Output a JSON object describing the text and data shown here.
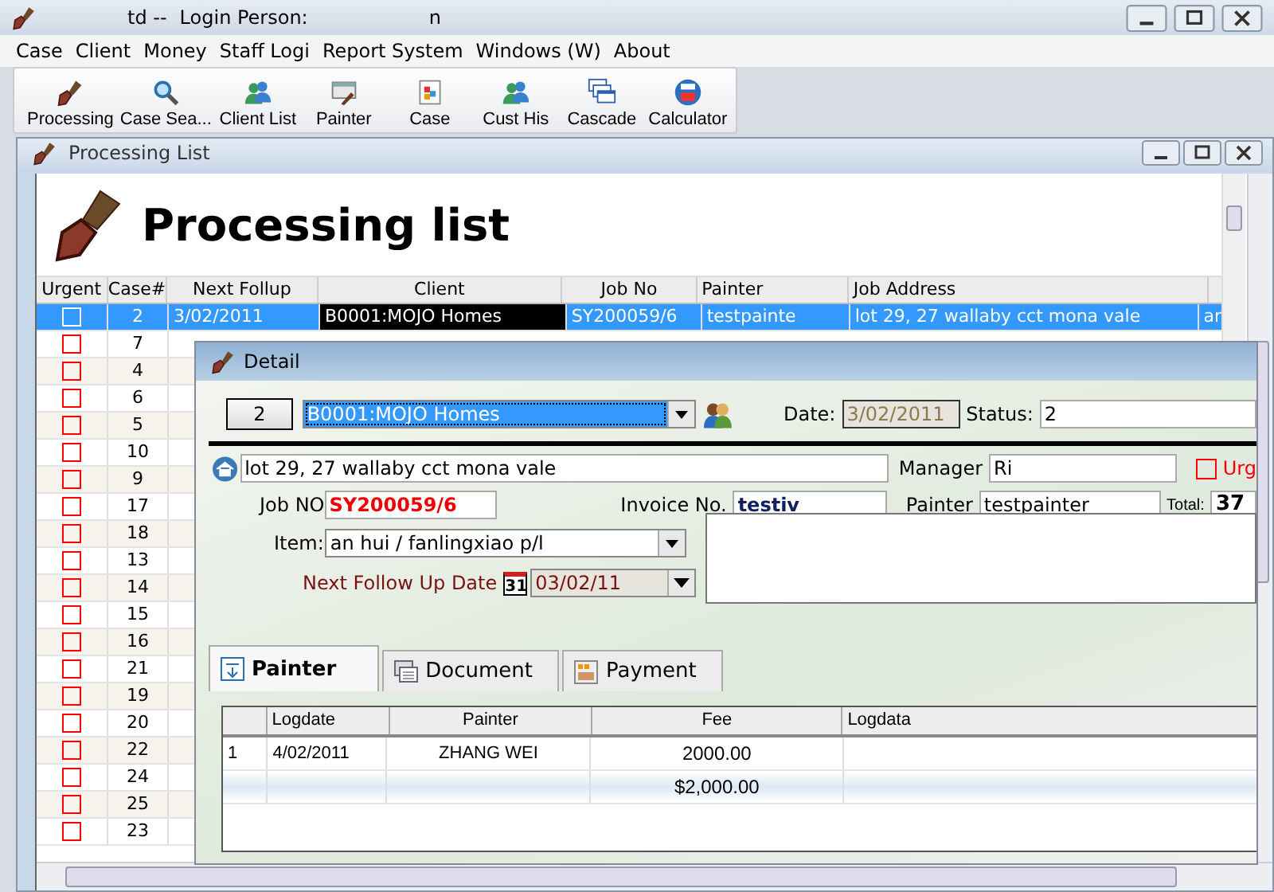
{
  "title_bar": {
    "texts": [
      "td --",
      "Login Person:",
      "n"
    ]
  },
  "menu": [
    "Case",
    "Client",
    "Money",
    "Staff Logi",
    "Report System",
    "Windows (W)",
    "About"
  ],
  "toolbar": [
    {
      "label": "Processing",
      "kind": "brush"
    },
    {
      "label": "Case Sea...",
      "kind": "search"
    },
    {
      "label": "Client List",
      "kind": "people"
    },
    {
      "label": "Painter",
      "kind": "painting"
    },
    {
      "label": "Case",
      "kind": "doc"
    },
    {
      "label": "Cust His",
      "kind": "people"
    },
    {
      "label": "Cascade",
      "kind": "cascade"
    },
    {
      "label": "Calculator",
      "kind": "calc"
    }
  ],
  "list_window": {
    "title": "Processing List",
    "heading": "Processing list",
    "columns": [
      "Urgent",
      "Case#",
      "Next Follup",
      "Client",
      "Job No",
      "Painter",
      "Job Address"
    ],
    "rows": [
      {
        "urgent": false,
        "case": "2",
        "selected": true,
        "cells": [
          "3/02/2011",
          "B0001:MOJO Homes",
          "SY200059/6",
          "testpainte",
          "lot 29, 27 wallaby cct mona vale",
          "ar"
        ]
      },
      {
        "urgent": false,
        "case": "7",
        "selected": false
      },
      {
        "urgent": false,
        "case": "4",
        "selected": false
      },
      {
        "urgent": false,
        "case": "6",
        "selected": false
      },
      {
        "urgent": false,
        "case": "5",
        "selected": false
      },
      {
        "urgent": false,
        "case": "10",
        "selected": false
      },
      {
        "urgent": false,
        "case": "9",
        "selected": false
      },
      {
        "urgent": false,
        "case": "17",
        "selected": false
      },
      {
        "urgent": false,
        "case": "18",
        "selected": false
      },
      {
        "urgent": false,
        "case": "13",
        "selected": false
      },
      {
        "urgent": false,
        "case": "14",
        "selected": false
      },
      {
        "urgent": false,
        "case": "15",
        "selected": false
      },
      {
        "urgent": false,
        "case": "16",
        "selected": false
      },
      {
        "urgent": false,
        "case": "21",
        "selected": false
      },
      {
        "urgent": false,
        "case": "19",
        "selected": false
      },
      {
        "urgent": false,
        "case": "20",
        "selected": false
      },
      {
        "urgent": false,
        "case": "22",
        "selected": false
      },
      {
        "urgent": false,
        "case": "24",
        "selected": false
      },
      {
        "urgent": false,
        "case": "25",
        "selected": false
      },
      {
        "urgent": false,
        "case": "23",
        "selected": false
      }
    ]
  },
  "detail": {
    "title": "Detail",
    "case_button": "2",
    "client": "B0001:MOJO Homes",
    "date_label": "Date:",
    "date": "3/02/2011",
    "status_label": "Status:",
    "status": "2",
    "address": "lot 29, 27 wallaby cct mona vale",
    "manager_label": "Manager",
    "manager": "Ri",
    "urgent_label": "Urg",
    "urgent": false,
    "job_no_label": "Job NO",
    "job_no": "SY200059/6",
    "invoice_label": "Invoice No.",
    "invoice": "testiv",
    "painter_label": "Painter",
    "painter": "testpainter",
    "total_label": "Total:",
    "total": "37",
    "item_label": "Item:",
    "item": "an hui / fanlingxiao p/l",
    "follow_label": "Next Follow Up Date",
    "calendar_day": "31",
    "follow_date": "03/02/11",
    "tabs": [
      {
        "label": "Painter",
        "selected": true,
        "kind": "painter"
      },
      {
        "label": "Document",
        "selected": false,
        "kind": "document"
      },
      {
        "label": "Payment",
        "selected": false,
        "kind": "payment"
      }
    ],
    "grid": {
      "columns": [
        "",
        "Logdate",
        "Painter",
        "Fee",
        "Logdata"
      ],
      "rows": [
        {
          "cells": [
            "1",
            "4/02/2011",
            "ZHANG WEI",
            "2000.00",
            ""
          ],
          "kind": "data"
        },
        {
          "cells": [
            "",
            "",
            "",
            "$2,000.00",
            ""
          ],
          "kind": "total"
        }
      ]
    }
  }
}
